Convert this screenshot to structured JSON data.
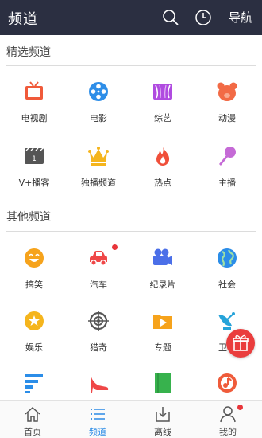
{
  "header": {
    "title": "频道",
    "nav_label": "导航",
    "icons": [
      "search-icon",
      "history-clock-icon"
    ]
  },
  "featured": {
    "title": "精选频道",
    "items": [
      {
        "label": "电视剧",
        "icon": "tv-icon",
        "color": "#f05a3a"
      },
      {
        "label": "电影",
        "icon": "film-reel-icon",
        "color": "#2e8ee8"
      },
      {
        "label": "综艺",
        "icon": "variety-curtain-icon",
        "color": "#b04be0"
      },
      {
        "label": "动漫",
        "icon": "bear-icon",
        "color": "#f26a45"
      },
      {
        "label": "V+播客",
        "icon": "vplus-clapper-icon",
        "color": "#555555"
      },
      {
        "label": "独播频道",
        "icon": "crown-icon",
        "color": "#f5b51d"
      },
      {
        "label": "热点",
        "icon": "flame-icon",
        "color": "#f04f3a"
      },
      {
        "label": "主播",
        "icon": "microphone-icon",
        "color": "#c56ad6"
      }
    ]
  },
  "other": {
    "title": "其他频道",
    "items": [
      {
        "label": "搞笑",
        "icon": "laughing-face-icon",
        "color": "#f6a31c"
      },
      {
        "label": "汽车",
        "icon": "car-icon",
        "color": "#ef4747",
        "badge": true
      },
      {
        "label": "纪录片",
        "icon": "camera-icon",
        "color": "#4b6fe8"
      },
      {
        "label": "社会",
        "icon": "globe-icon",
        "color": "#2b8de8"
      },
      {
        "label": "娱乐",
        "icon": "star-icon",
        "color": "#f5b51d"
      },
      {
        "label": "猎奇",
        "icon": "crosshair-icon",
        "color": "#555555"
      },
      {
        "label": "专题",
        "icon": "folder-play-icon",
        "color": "#f6a31c"
      },
      {
        "label": "卫视",
        "icon": "satellite-icon",
        "color": "#26a3d9"
      },
      {
        "label": "",
        "icon": "list-bars-icon",
        "color": "#2b8de8"
      },
      {
        "label": "",
        "icon": "high-heel-icon",
        "color": "#ef4747"
      },
      {
        "label": "",
        "icon": "book-icon",
        "color": "#37b24d"
      },
      {
        "label": "",
        "icon": "music-note-icon",
        "color": "#ef5b3a"
      }
    ]
  },
  "floating": {
    "icon": "gift-icon",
    "color": "#ea3d3d"
  },
  "bottom_nav": {
    "tabs": [
      {
        "label": "首页",
        "icon": "home-icon",
        "active": false
      },
      {
        "label": "频道",
        "icon": "channel-list-icon",
        "active": true
      },
      {
        "label": "离线",
        "icon": "download-icon",
        "active": false
      },
      {
        "label": "我的",
        "icon": "user-icon",
        "active": false,
        "badge": true
      }
    ],
    "active_color": "#2a8be6"
  }
}
